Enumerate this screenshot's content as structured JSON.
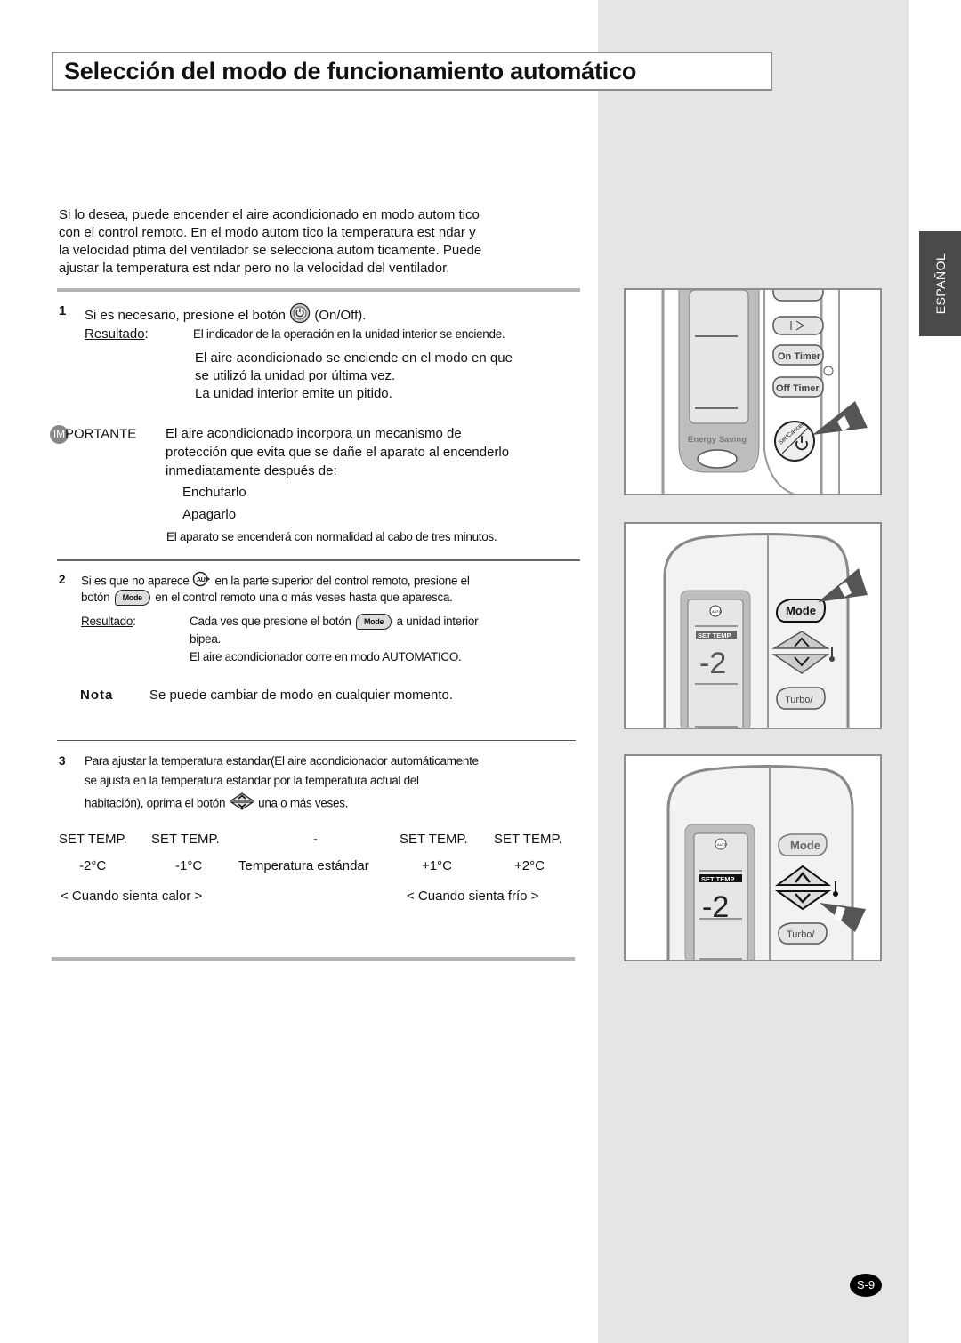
{
  "title": "Selección del modo de funcionamiento automático",
  "language_tab": "ESPAÑOL",
  "intro": [
    "Si lo desea, puede encender el aire acondicionado en modo autom tico",
    "con el control remoto. En el modo autom tico la temperatura est ndar y",
    "la velocidad  ptima del ventilador se selecciona autom ticamente. Puede",
    "ajustar la temperatura est ndar pero no la velocidad del ventilador."
  ],
  "step1": {
    "number": "1",
    "text_before": "Si es necesario, presione el botón",
    "text_after": "(On/Off).",
    "result_label": "Resultado",
    "result_colon": ":",
    "results": [
      "El indicador de la operación en la unidad interior se enciende.",
      "El aire acondicionado se enciende en el modo en que",
      "se utilizó la unidad por última vez.",
      "La unidad interior emite un pitido."
    ]
  },
  "important": {
    "badge": "IM",
    "label": "PORTANTE",
    "lines": [
      "El aire acondicionado incorpora un mecanismo de",
      "protección que evita que se dañe el aparato al encenderlo",
      "inmediatamente después de:"
    ],
    "items": [
      "Enchufarlo",
      "Apagarlo"
    ],
    "footer": "El aparato se encenderá con normalidad al cabo de tres minutos."
  },
  "step2": {
    "number": "2",
    "line1_before": "Si es que no aparece",
    "line1_after": "en la parte superior del control remoto, presione el",
    "line2_before": "botón",
    "line2_after": "en el control remoto una o más veses hasta que aparesca.",
    "mode_label": "Mode",
    "result_label": "Resultado",
    "result_colon": ":",
    "result1_before": "Cada ves que presione el botón",
    "result1_after": "a unidad interior",
    "result2": "bipea.",
    "result3": "El aire acondicionador corre en modo AUTOMATICO."
  },
  "note": {
    "label": "Nota",
    "text": "Se puede cambiar de modo en cualquier momento."
  },
  "step3": {
    "number": "3",
    "lines": [
      "Para ajustar la temperatura estandar(El aire acondicionador automáticamente",
      "se ajusta en la temperatura estandar por la temperatura actual del"
    ],
    "line3_before": "habitación), oprima el botón",
    "line3_after": "una o más veses."
  },
  "temp_table": {
    "headers": [
      "SET TEMP.",
      "SET TEMP.",
      "-",
      "SET TEMP.",
      "SET TEMP."
    ],
    "values": [
      "-2°C",
      "-1°C",
      "Temperatura estándar",
      "+1°C",
      "+2°C"
    ],
    "hint_hot": "< Cuando sienta calor >",
    "hint_cold": "< Cuando sienta frío >"
  },
  "figures": {
    "fig1": {
      "on_timer": "On Timer",
      "off_timer": "Off Timer",
      "energy_saving": "Energy Saving",
      "set_cancel": "Set/Cancel"
    },
    "fig2": {
      "mode": "Mode",
      "set_temp": "SET TEMP",
      "display_value": "-2",
      "turbo": "Turbo/",
      "auto": "AUTO"
    },
    "fig3": {
      "mode": "Mode",
      "set_temp": "SET TEMP",
      "display_value": "-2",
      "turbo": "Turbo/",
      "auto": "AUTO"
    }
  },
  "page_number": "S-9",
  "colors": {
    "sidebar_gray": "#e5e5e5",
    "tab_dark": "#4a4a4a",
    "border_gray": "#8d8d8d",
    "pointer_gray": "#555555"
  }
}
